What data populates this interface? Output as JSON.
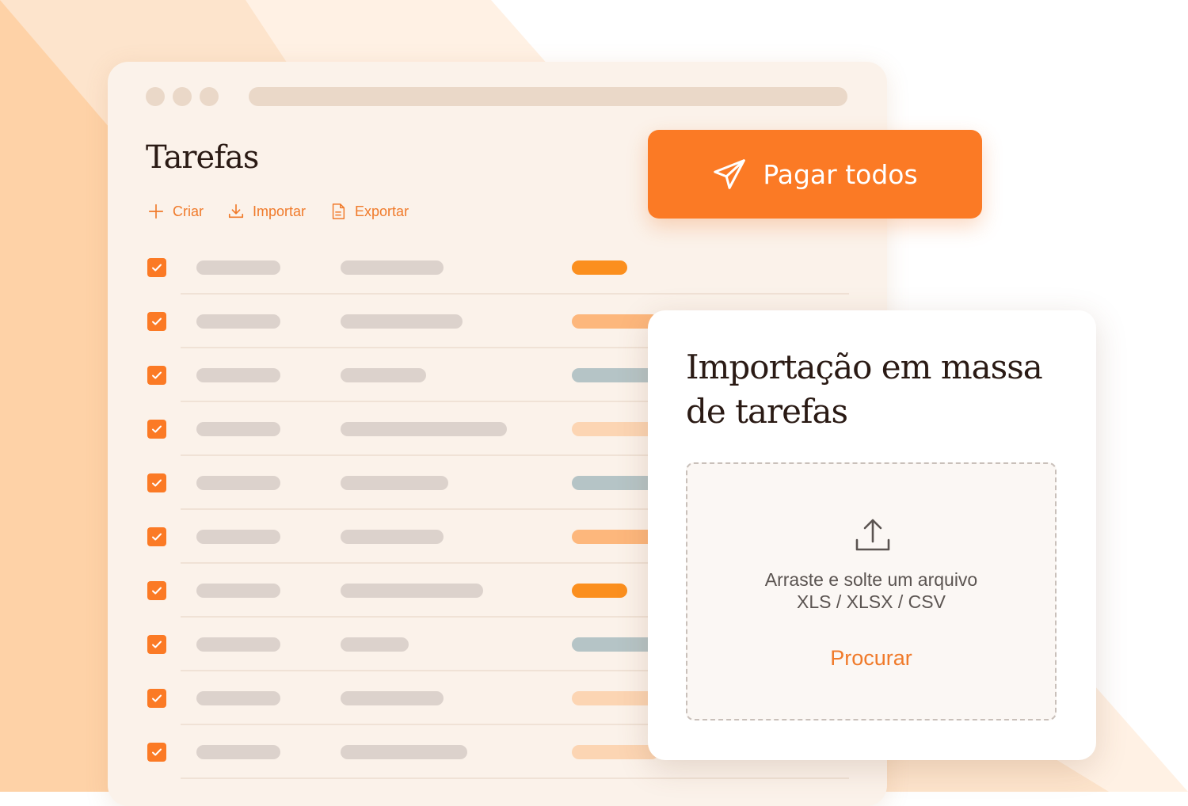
{
  "colors": {
    "accent": "#fb7a25",
    "accent_text": "#f07a2a",
    "window_bg": "#fbf2ea",
    "placeholder": "#dcd2cc",
    "status_orange": "#fb8f1e",
    "status_light_orange": "#fdb77c",
    "status_gray_blue": "#b5c4c6",
    "status_pale_orange": "#fcd5b3"
  },
  "page": {
    "title": "Tarefas"
  },
  "actions": [
    {
      "label": "Criar",
      "icon": "plus-icon"
    },
    {
      "label": "Importar",
      "icon": "download-icon"
    },
    {
      "label": "Exportar",
      "icon": "file-icon"
    }
  ],
  "task_rows": [
    {
      "checked": true,
      "status_color": "#fb8f1e"
    },
    {
      "checked": true,
      "status_color": "#fdb77c"
    },
    {
      "checked": true,
      "status_color": "#b5c4c6"
    },
    {
      "checked": true,
      "status_color": "#fcd5b3"
    },
    {
      "checked": true,
      "status_color": "#b5c4c6"
    },
    {
      "checked": true,
      "status_color": "#fdb77c"
    },
    {
      "checked": true,
      "status_color": "#fb8f1e"
    },
    {
      "checked": true,
      "status_color": "#b5c4c6"
    },
    {
      "checked": true,
      "status_color": "#fcd5b3"
    },
    {
      "checked": true,
      "status_color": "#fcd5b3"
    }
  ],
  "pay_button": {
    "label": "Pagar todos",
    "icon": "send-icon"
  },
  "import_modal": {
    "title": "Importação em massa de tarefas",
    "upload_icon": "upload-icon",
    "drop_text_line1": "Arraste e solte um arquivo",
    "drop_text_line2": "XLS / XLSX / CSV",
    "browse_label": "Procurar"
  }
}
